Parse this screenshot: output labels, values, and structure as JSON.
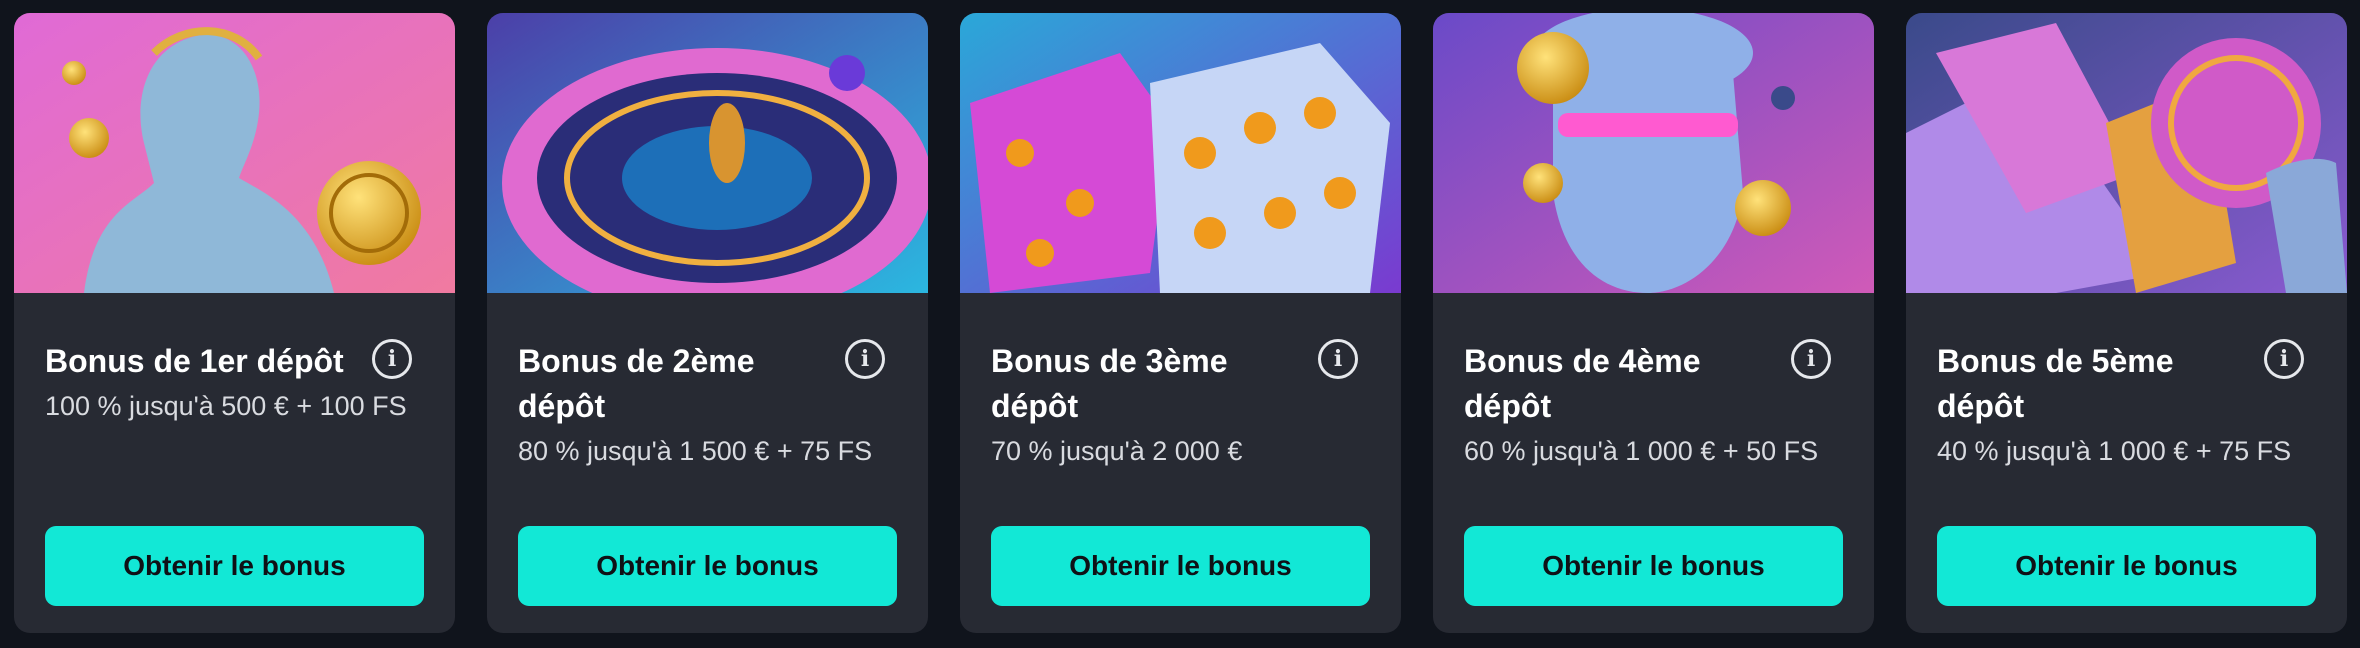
{
  "bonuses": [
    {
      "title": "Bonus de 1er dépôt",
      "description": "100 % jusqu'à 500 € + 100 FS",
      "button_label": "Obtenir le bonus"
    },
    {
      "title": "Bonus de 2ème dépôt",
      "description": "80 % jusqu'à 1 500 € + 75 FS",
      "button_label": "Obtenir le bonus"
    },
    {
      "title": "Bonus de 3ème dépôt",
      "description": "70 % jusqu'à 2 000 €",
      "button_label": "Obtenir le bonus"
    },
    {
      "title": "Bonus de 4ème dépôt",
      "description": "60 % jusqu'à 1 000 € + 50 FS",
      "button_label": "Obtenir le bonus"
    },
    {
      "title": "Bonus de 5ème dépôt",
      "description": "40 % jusqu'à 1 000 € + 75 FS",
      "button_label": "Obtenir le bonus"
    }
  ],
  "icons": {
    "info": "info-icon"
  },
  "colors": {
    "card_bg": "#272a33",
    "page_bg": "#10141c",
    "button_accent": "#12e8d6"
  }
}
